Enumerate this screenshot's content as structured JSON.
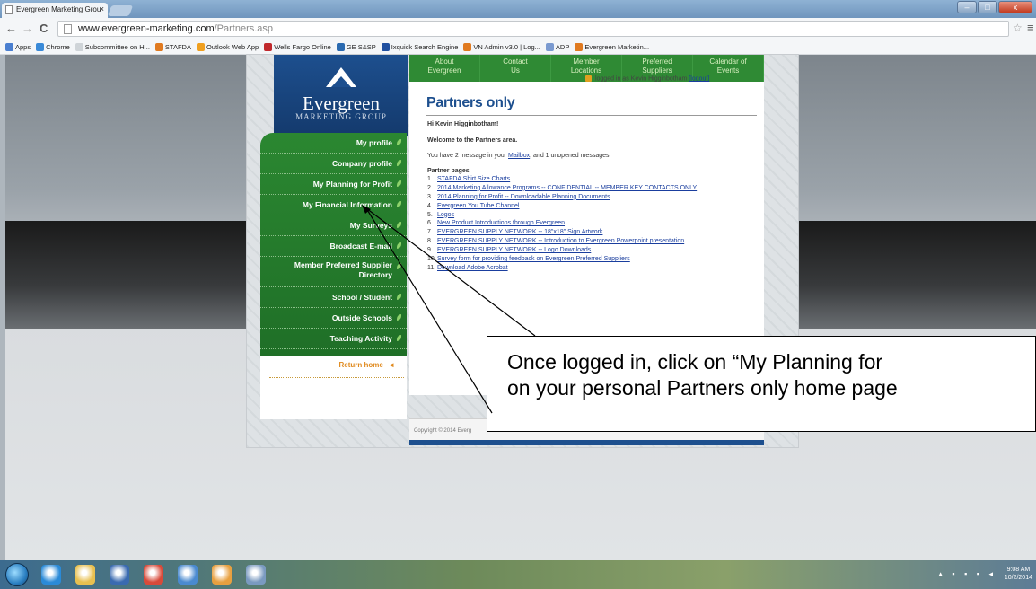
{
  "browser": {
    "tab_title": "Evergreen Marketing Grou",
    "tab_close": "×",
    "url_host": "www.evergreen-marketing.com",
    "url_path": "/Partners.asp",
    "back": "←",
    "forward": "→",
    "reload": "C",
    "star": "☆",
    "menu": "≡",
    "win_min": "–",
    "win_max": "□",
    "win_close": "x"
  },
  "bookmarks": [
    {
      "label": "Apps",
      "color": "#4a7fd0"
    },
    {
      "label": "Chrome",
      "color": "#3a8ad8"
    },
    {
      "label": "Subcommittee on H...",
      "color": "#cfd4d8"
    },
    {
      "label": "STAFDA",
      "color": "#e07a20"
    },
    {
      "label": "Outlook Web App",
      "color": "#f0a020"
    },
    {
      "label": "Wells Fargo Online",
      "color": "#c0282c"
    },
    {
      "label": "GE S&SP",
      "color": "#2a6ab0"
    },
    {
      "label": "Ixquick Search Engine",
      "color": "#2050a0"
    },
    {
      "label": "VN Admin v3.0 | Log...",
      "color": "#e07a20"
    },
    {
      "label": "ADP",
      "color": "#7a9ad0"
    },
    {
      "label": "Evergreen Marketin...",
      "color": "#e07a20"
    }
  ],
  "site": {
    "logo_name": "Evergreen",
    "logo_sub": "MARKETING GROUP",
    "topnav": [
      {
        "line1": "About",
        "line2": "Evergreen"
      },
      {
        "line1": "Contact",
        "line2": "Us"
      },
      {
        "line1": "Member",
        "line2": "Locations"
      },
      {
        "line1": "Preferred",
        "line2": "Suppliers"
      },
      {
        "line1": "Calendar of",
        "line2": "Events"
      }
    ],
    "sidenav": [
      "My profile",
      "Company profile",
      "My Planning for Profit",
      "My Financial Information",
      "My Surveys",
      "Broadcast E-mail",
      "Member Preferred Supplier Directory",
      "School / Student",
      "Outside Schools",
      "Teaching Activity"
    ],
    "return_home": "Return home",
    "return_arrow": "◄",
    "login_prefix": "logged in as Kevin Higginbotham",
    "logout": "[logout]",
    "page_title": "Partners only",
    "greeting": "Hi Kevin Higginbotham!",
    "welcome": "Welcome to the Partners area.",
    "msg_before": "You have 2 message in your ",
    "mailbox": "Mailbox",
    "msg_after": ", and 1 unopened messages.",
    "partner_pages_heading": "Partner pages",
    "partner_pages": [
      {
        "num": "1.",
        "text": "STAFDA Shirt Size Charts"
      },
      {
        "num": "2.",
        "text": "2014 Marketing Allowance Programs -- CONFIDENTIAL -- MEMBER KEY CONTACTS ONLY"
      },
      {
        "num": "3.",
        "text": "2014 Planning for Profit -- Downloadable Planning Documents"
      },
      {
        "num": "4.",
        "text": "Evergreen You Tube Channel"
      },
      {
        "num": "5.",
        "text": "Logos"
      },
      {
        "num": "6.",
        "text": "New Product Introductions through Evergreen"
      },
      {
        "num": "7.",
        "text": "EVERGREEN SUPPLY NETWORK -- 18\"x18\" Sign Artwork"
      },
      {
        "num": "8.",
        "text": "EVERGREEN SUPPLY NETWORK -- Introduction to Evergreen Powerpoint presentation"
      },
      {
        "num": "9.",
        "text": "EVERGREEN SUPPLY NETWORK -- Logo Downloads"
      },
      {
        "num": "10.",
        "text": "Survey form for providing feedback on Evergreen Preferred Suppliers"
      },
      {
        "num": "11.",
        "text": "Download Adobe Acrobat"
      }
    ],
    "copyright": "Copyright © 2014 Everg"
  },
  "callout": {
    "line1": "Once logged in, click on “My Planning for",
    "line2": "on your personal Partners only home page"
  },
  "taskbar": {
    "time": "9:08 AM",
    "date": "10/2/2014",
    "apps": [
      {
        "name": "ie-icon",
        "color": "#2a8ad8"
      },
      {
        "name": "explorer-icon",
        "color": "#e8c050"
      },
      {
        "name": "media-icon",
        "color": "#3a6ab0"
      },
      {
        "name": "chrome-icon",
        "color": "#d84a3a"
      },
      {
        "name": "network-icon",
        "color": "#4a8ad0"
      },
      {
        "name": "mail-icon",
        "color": "#e8a040"
      },
      {
        "name": "window-icon",
        "color": "#7a9ac0"
      }
    ]
  }
}
